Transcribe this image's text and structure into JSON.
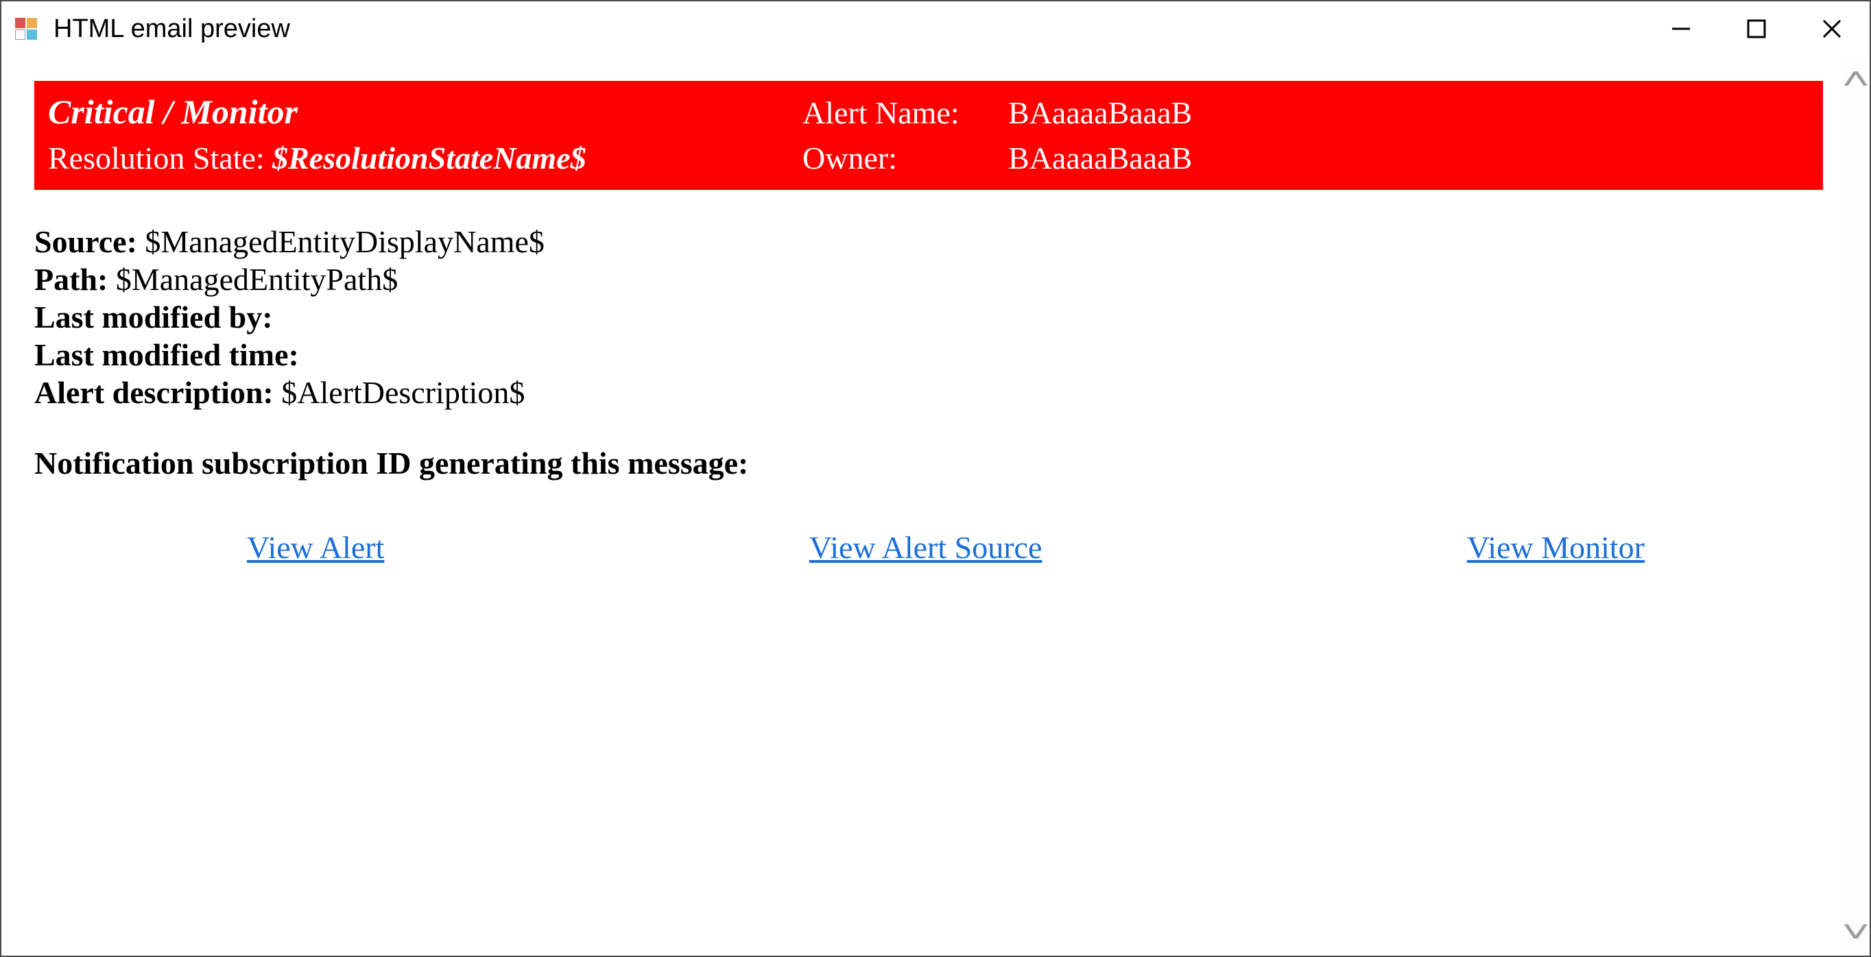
{
  "window": {
    "title": "HTML email preview"
  },
  "header_band": {
    "crit_monitor": "Critical / Monitor",
    "alert_name_label": "Alert Name:",
    "alert_name_value": "BAaaaaBaaaB",
    "resolution_state_label": "Resolution State: ",
    "resolution_state_value": "$ResolutionStateName$",
    "owner_label": "Owner:",
    "owner_value": "BAaaaaBaaaB"
  },
  "fields": {
    "source_label": "Source: ",
    "source_value": "$ManagedEntityDisplayName$",
    "path_label": "Path: ",
    "path_value": "$ManagedEntityPath$",
    "last_modified_by_label": "Last modified by:",
    "last_modified_by_value": "",
    "last_modified_time_label": "Last modified time:",
    "last_modified_time_value": "",
    "alert_description_label": "Alert description: ",
    "alert_description_value": "$AlertDescription$"
  },
  "subscription_id_label": "Notification subscription ID generating this message:",
  "links": {
    "view_alert": "View Alert",
    "view_alert_source": "View Alert Source",
    "view_monitor": "View Monitor"
  },
  "colors": {
    "band_bg": "#ff0000",
    "link": "#1a6fd6"
  }
}
